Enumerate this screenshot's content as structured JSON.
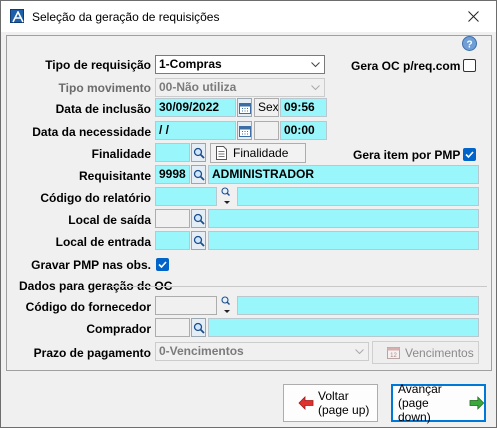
{
  "window": {
    "title": "Seleção da geração de requisições"
  },
  "labels": {
    "tipo_requisicao": "Tipo de requisição",
    "tipo_movimento": "Tipo movimento",
    "data_inclusao": "Data de inclusão",
    "data_necessidade": "Data da necessidade",
    "finalidade": "Finalidade",
    "requisitante": "Requisitante",
    "codigo_relatorio": "Código do relatório",
    "local_saida": "Local de saída",
    "local_entrada": "Local de entrada",
    "gravar_pmp": "Gravar PMP nas obs.",
    "gera_oc": "Gera OC p/req.com",
    "gera_item_pmp": "Gera item por PMP",
    "codigo_fornecedor": "Código do fornecedor",
    "comprador": "Comprador",
    "prazo_pagamento": "Prazo de pagamento"
  },
  "group": {
    "title": "Dados para geração de OC"
  },
  "values": {
    "tipo_requisicao": "1-Compras",
    "tipo_movimento": "00-Não utiliza",
    "data_inclusao": "30/09/2022",
    "dia_semana_inclusao": "Sex",
    "hora_inclusao": "09:56",
    "data_necessidade": " /  /",
    "dia_semana_necessidade": "",
    "hora_necessidade": "00:00",
    "finalidade": "",
    "requisitante_codigo": "9998",
    "requisitante_nome": "ADMINISTRADOR",
    "prazo_pagamento": "0-Vencimentos"
  },
  "checkboxes": {
    "gera_oc": false,
    "gera_item_pmp": true,
    "gravar_pmp": true
  },
  "buttons": {
    "finalidade": "Finalidade",
    "vencimentos": "Vencimentos",
    "voltar_line1": "Voltar",
    "voltar_line2": "(page up)",
    "avancar_line1": "Avançar",
    "avancar_line2": "(page down)"
  },
  "colors": {
    "field_accent": "#99f6fa",
    "checkbox_checked": "#0064c8",
    "voltar_arrow": "#e0302e",
    "avancar_arrow": "#3aa83a",
    "focus_border": "#0078d7"
  },
  "icons": [
    "app-icon",
    "close-icon",
    "help-icon",
    "calendar-icon",
    "lookup-icon",
    "document-icon",
    "calendar-page-icon",
    "arrow-left-icon",
    "arrow-right-icon",
    "chevron-down-icon"
  ]
}
